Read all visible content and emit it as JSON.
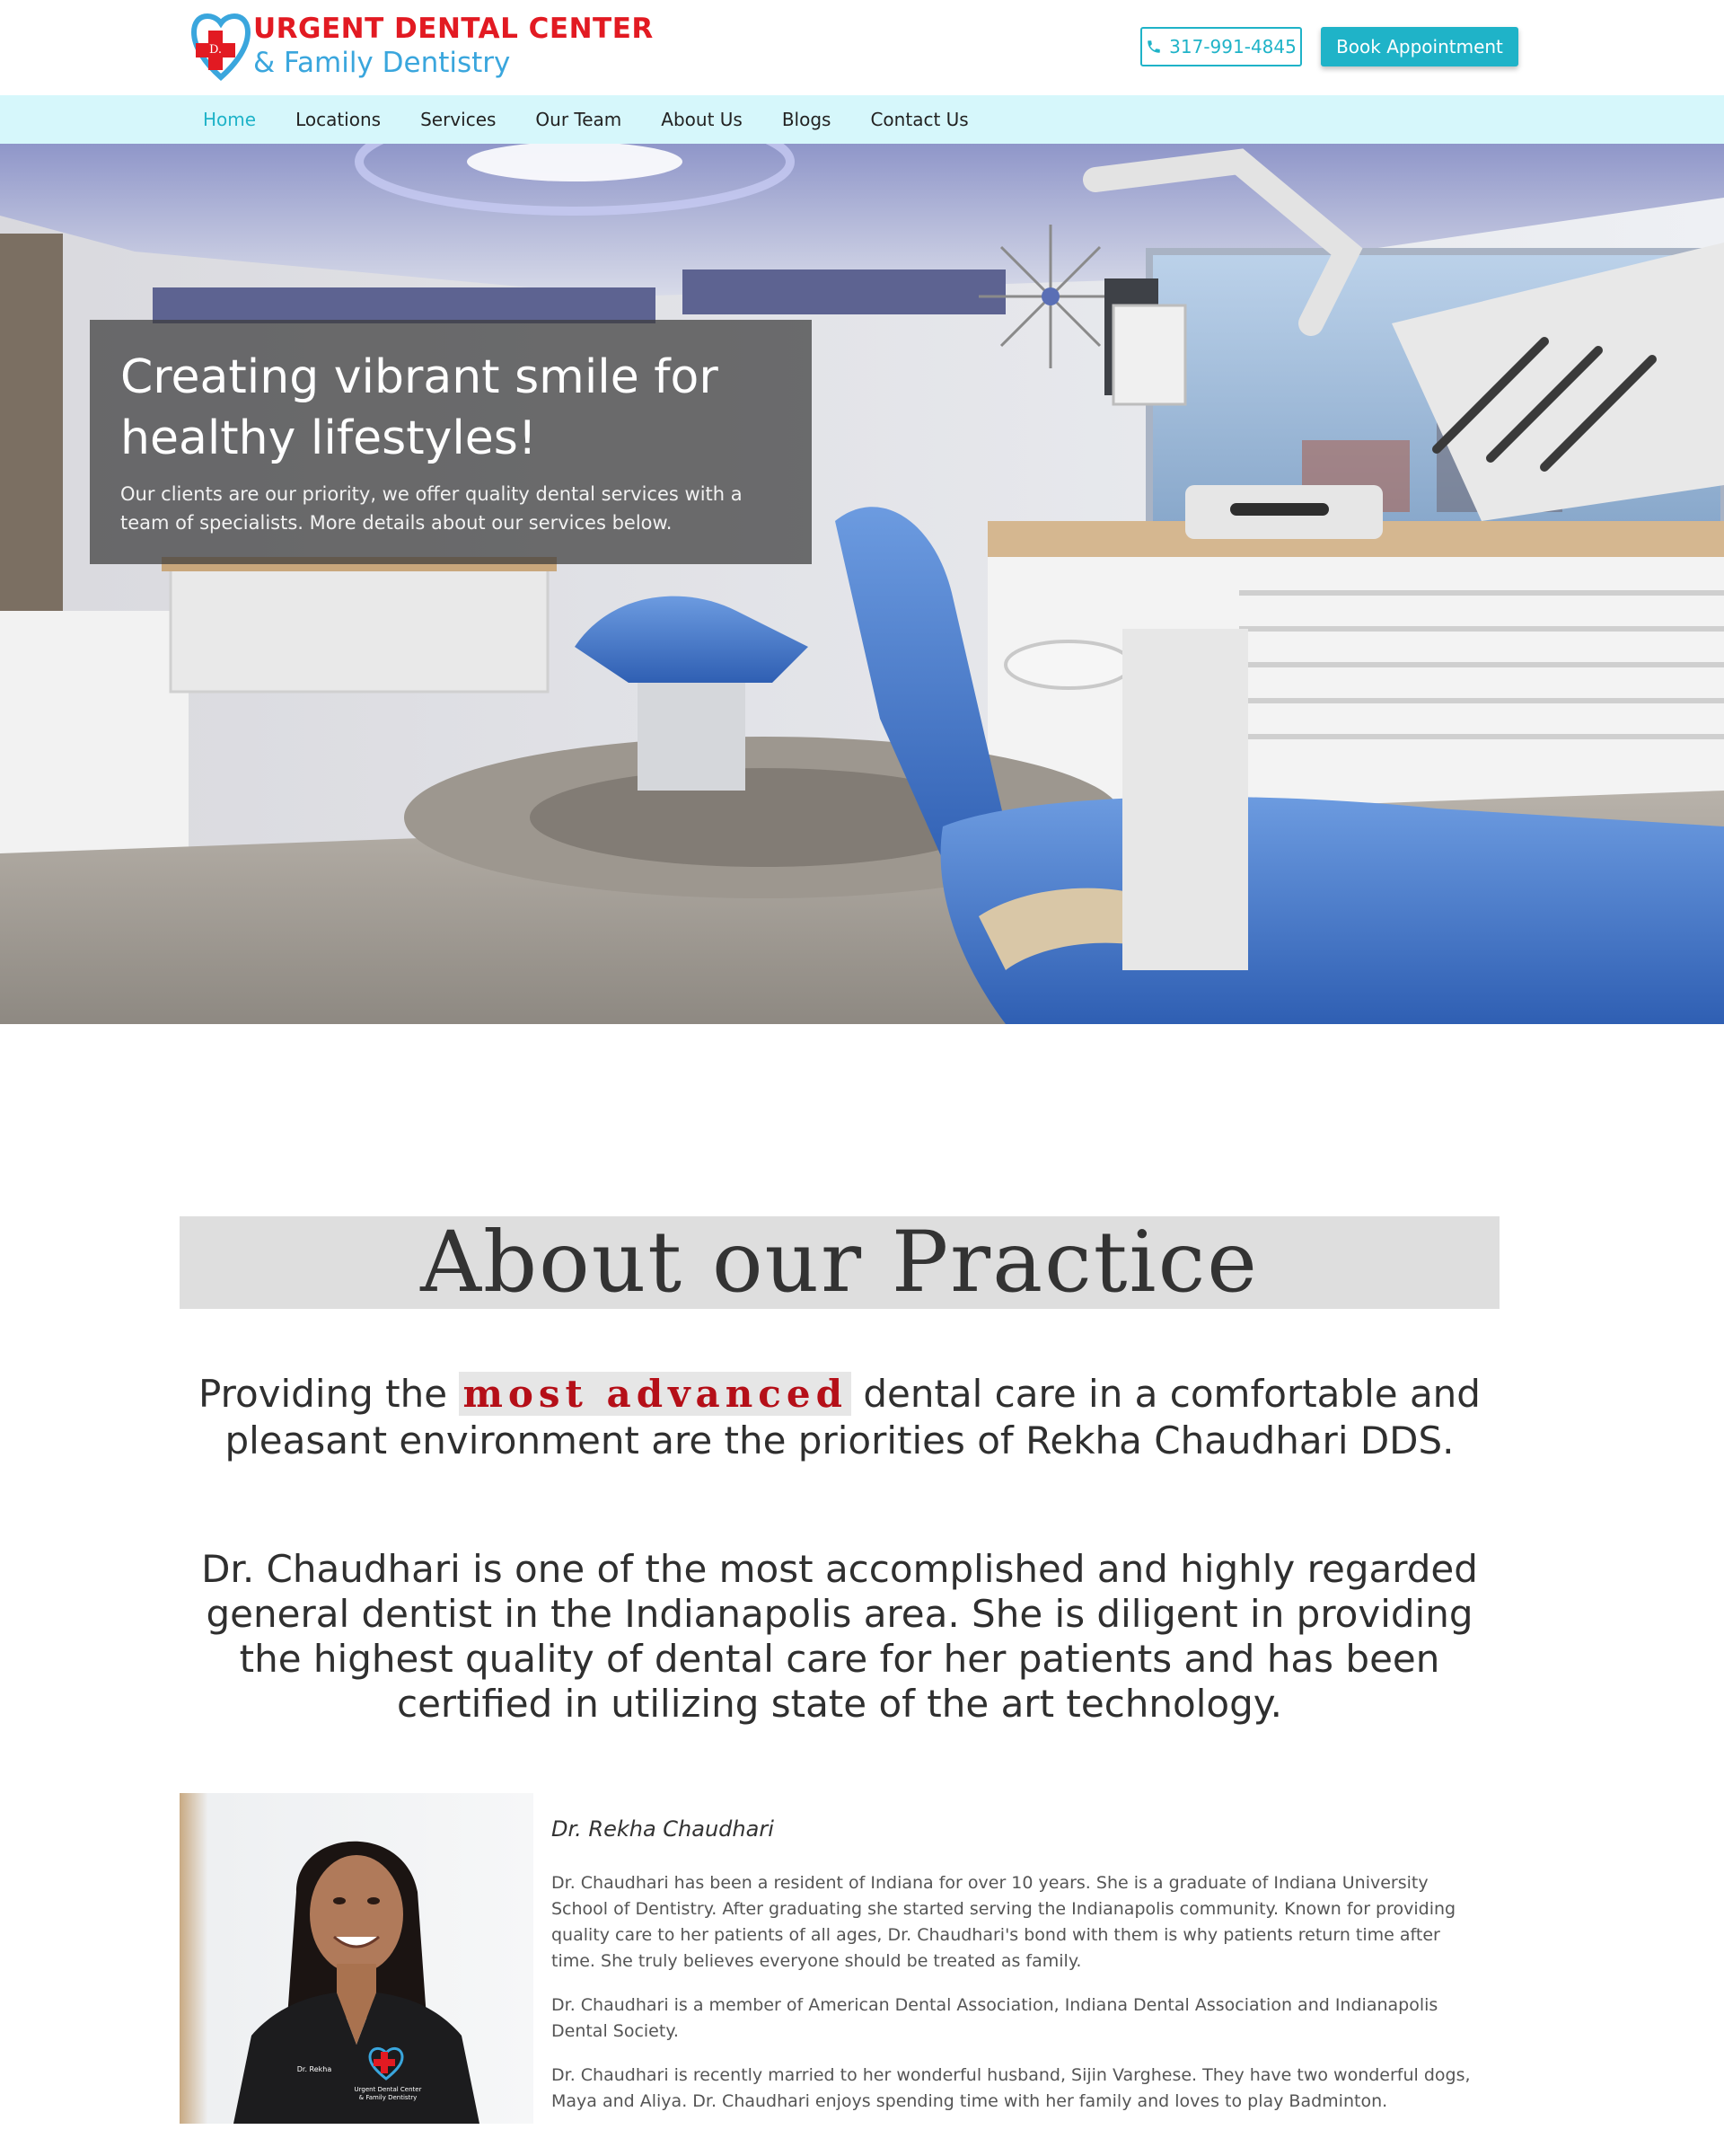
{
  "header": {
    "logo_line1": "URGENT DENTAL CENTER",
    "logo_line2": "& Family Dentistry",
    "logo_mark_text": "D.",
    "phone": "317-991-4845",
    "book_label": "Book Appointment"
  },
  "nav": {
    "items": [
      "Home",
      "Locations",
      "Services",
      "Our Team",
      "About Us",
      "Blogs",
      "Contact Us"
    ],
    "active": "Home"
  },
  "hero": {
    "title_line1": "Creating vibrant smile for",
    "title_line2": "healthy lifestyles!",
    "subtitle_line1": "Our clients are our priority, we offer quality dental services with a",
    "subtitle_line2": "team of specialists. More details about our services below."
  },
  "about": {
    "heading": "About our Practice",
    "lead_before": "Providing the",
    "lead_highlight": "most advanced",
    "lead_after": "dental care in a comfortable and pleasant environment are the priorities of Rekha Chaudhari DDS.",
    "intro": "Dr. Chaudhari is one of the most accomplished and highly regarded general dentist in the Indianapolis area.  She is diligent in providing the highest quality of dental care for her patients and has been certified in utilizing state of the art technology."
  },
  "doctor": {
    "name": "Dr. Rekha Chaudhari",
    "bio1": "Dr. Chaudhari has been a resident of Indiana for over 10 years. She is a graduate of Indiana University School of Dentistry. After graduating she started serving the Indianapolis community.  Known for providing quality care to her patients of all ages, Dr. Chaudhari's bond with them is why patients return time after time. She truly believes everyone should be treated as family.",
    "bio2": "Dr. Chaudhari is a member of American Dental Association, Indiana Dental Association and Indianapolis Dental Society.",
    "bio3": "Dr. Chaudhari is recently married to her wonderful husband, Sijin Varghese. They have two wonderful dogs, Maya and Aliya. Dr. Chaudhari enjoys spending time with her family and loves to play Badminton.",
    "scrub_logo_line1": "Urgent Dental Center",
    "scrub_logo_line2": "& Family Dentistry",
    "scrub_name": "Dr. Rekha"
  },
  "colors": {
    "accent": "#1fb3c8",
    "brand_red": "#e21a22",
    "brand_blue": "#3aa6dd",
    "nav_bg": "#d6f7fb"
  }
}
